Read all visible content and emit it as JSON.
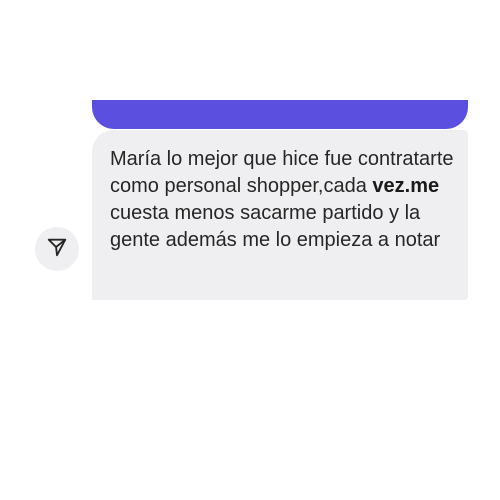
{
  "chat": {
    "previous_bubble_color": "#5b4fe0",
    "message": {
      "text_before_bold": "María lo mejor que hice fue contratarte como personal shopper,cada ",
      "bold_text": "vez.me",
      "text_after_bold": " cuesta menos sacarme partido y la gente además me lo empieza a notar",
      "bubble_color": "#efeff1"
    },
    "share_button": {
      "icon": "send-icon"
    }
  }
}
